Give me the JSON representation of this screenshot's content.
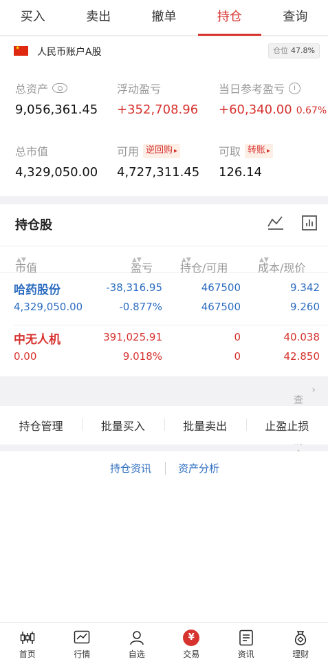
{
  "tabs": [
    "买入",
    "卖出",
    "撤单",
    "持仓",
    "查询"
  ],
  "account": {
    "name": "人民币账户A股",
    "position_label": "仓位",
    "position_value": "47.8%"
  },
  "summary": {
    "total_assets_label": "总资产",
    "total_assets": "9,056,361.45",
    "floating_pl_label": "浮动盈亏",
    "floating_pl": "+352,708.96",
    "daily_pl_label": "当日参考盈亏",
    "daily_pl": "+60,340.00",
    "daily_pl_pct": "0.67%",
    "market_value_label": "总市值",
    "market_value": "4,329,050.00",
    "available_label": "可用",
    "available": "4,727,311.45",
    "reverse_repo_label": "逆回购",
    "withdrawable_label": "可取",
    "withdrawable": "126.14",
    "transfer_label": "转账"
  },
  "holdings": {
    "title": "持仓股",
    "columns": [
      "市值",
      "盈亏",
      "持仓/可用",
      "成本/现价"
    ],
    "rows": [
      {
        "name": "哈药股份",
        "market_value": "4,329,050.00",
        "pl": "-38,316.95",
        "pl_pct": "-0.877%",
        "position": "467500",
        "available": "467500",
        "cost": "9.342",
        "price": "9.260"
      },
      {
        "name": "中无人机",
        "market_value": "0.00",
        "pl": "391,025.91",
        "pl_pct": "9.018%",
        "position": "0",
        "available": "0",
        "cost": "40.038",
        "price": "42.850"
      }
    ]
  },
  "cleared_label": "查看已清仓股票",
  "actions": [
    "持仓管理",
    "批量买入",
    "批量卖出",
    "止盈止损"
  ],
  "links": {
    "news": "持仓资讯",
    "analysis": "资产分析"
  },
  "nav": [
    {
      "label": "首页",
      "icon": "candlestick-icon"
    },
    {
      "label": "行情",
      "icon": "chart-icon"
    },
    {
      "label": "自选",
      "icon": "person-icon"
    },
    {
      "label": "交易",
      "icon": "yen-icon"
    },
    {
      "label": "资讯",
      "icon": "document-icon"
    },
    {
      "label": "理财",
      "icon": "moneybag-icon"
    }
  ],
  "colors": {
    "accent": "#d6322e",
    "link": "#2c6dc0"
  }
}
